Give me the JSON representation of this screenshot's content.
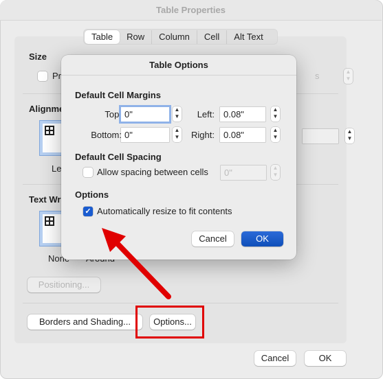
{
  "window": {
    "title": "Table Properties"
  },
  "tabs": [
    {
      "label": "Table",
      "selected": true
    },
    {
      "label": "Row"
    },
    {
      "label": "Column"
    },
    {
      "label": "Cell"
    },
    {
      "label": "Alt Text"
    }
  ],
  "size": {
    "heading": "Size",
    "preferred_width_partial": "Pre",
    "unit_partial": "s"
  },
  "alignment": {
    "heading_partial": "Alignme",
    "left_label_partial": "Lef"
  },
  "text_wrapping": {
    "heading_partial": "Text Wra",
    "none_label": "None",
    "around_label": "Around"
  },
  "buttons": {
    "positioning": "Positioning...",
    "borders_shading": "Borders and Shading...",
    "options": "Options...",
    "cancel": "Cancel",
    "ok": "OK"
  },
  "modal": {
    "title": "Table Options",
    "margins": {
      "heading": "Default Cell Margins",
      "top_label": "Top:",
      "top_value": "0\"",
      "bottom_label": "Bottom:",
      "bottom_value": "0\"",
      "left_label": "Left:",
      "left_value": "0.08\"",
      "right_label": "Right:",
      "right_value": "0.08\""
    },
    "spacing": {
      "heading": "Default Cell Spacing",
      "checkbox_label": "Allow spacing between cells",
      "checked": false,
      "value": "0\""
    },
    "options": {
      "heading": "Options",
      "checkbox_label": "Automatically resize to fit contents",
      "checked": true
    },
    "cancel": "Cancel",
    "ok": "OK"
  },
  "annotation": {
    "color": "#e00000"
  }
}
